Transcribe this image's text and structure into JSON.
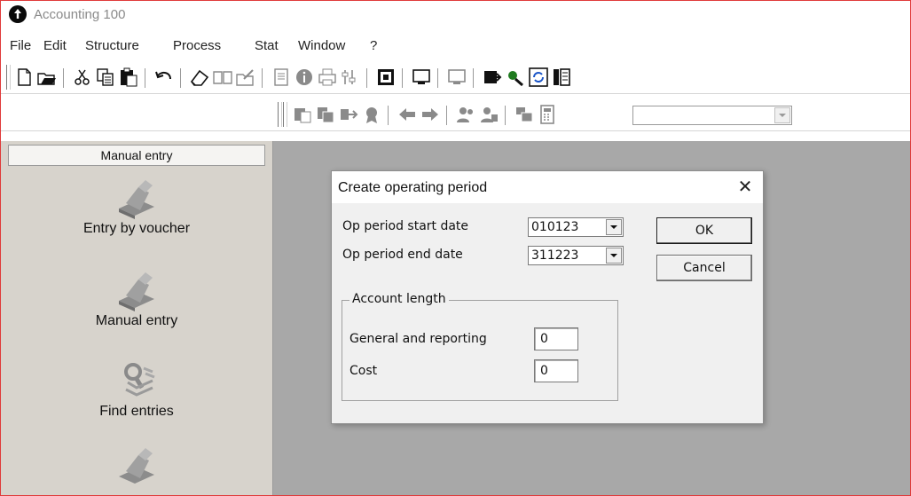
{
  "app": {
    "title": "Accounting 100"
  },
  "menu": [
    "File",
    "Edit",
    "Structure",
    "Process",
    "Stat",
    "Window",
    "?"
  ],
  "toolbar1": {
    "icons": [
      "new-document-icon",
      "open-folder-icon",
      "cut-icon",
      "copy-icon",
      "paste-icon",
      "undo-icon",
      "eraser-icon",
      "book-icon",
      "folder-edit-icon",
      "page-icon",
      "info-icon",
      "printer-icon",
      "settings-icon",
      "module-icon",
      "monitor-icon",
      "monitor-disabled-icon",
      "export-icon",
      "tools-icon",
      "refresh-icon",
      "columns-icon"
    ]
  },
  "toolbar2": {
    "icons": [
      "copy-entry-icon",
      "duplicate-entry-icon",
      "transfer-icon",
      "badge-icon",
      "back-arrow-icon",
      "forward-arrow-icon",
      "users-icon",
      "user-group-icon",
      "stack-icon",
      "calculator-icon"
    ],
    "combo_value": ""
  },
  "sidebar": {
    "header": "Manual entry",
    "items": [
      {
        "label": "Entry by voucher",
        "icon": "entry-voucher-icon"
      },
      {
        "label": "Manual entry",
        "icon": "manual-entry-icon"
      },
      {
        "label": "Find entries",
        "icon": "find-entries-icon"
      },
      {
        "label": "",
        "icon": "entry-icon"
      }
    ]
  },
  "dialog": {
    "title": "Create operating period",
    "start_label": "Op period start date",
    "start_value": "010123",
    "end_label": "Op period end date",
    "end_value": "311223",
    "ok": "OK",
    "cancel": "Cancel",
    "group": {
      "title": "Account length",
      "general_label": "General and reporting",
      "general_value": "0",
      "cost_label": "Cost",
      "cost_value": "0"
    }
  },
  "colors": {
    "workspace": "#a8a8a8",
    "sidebar": "#d7d3cc",
    "frame_border": "#e03a3a"
  }
}
